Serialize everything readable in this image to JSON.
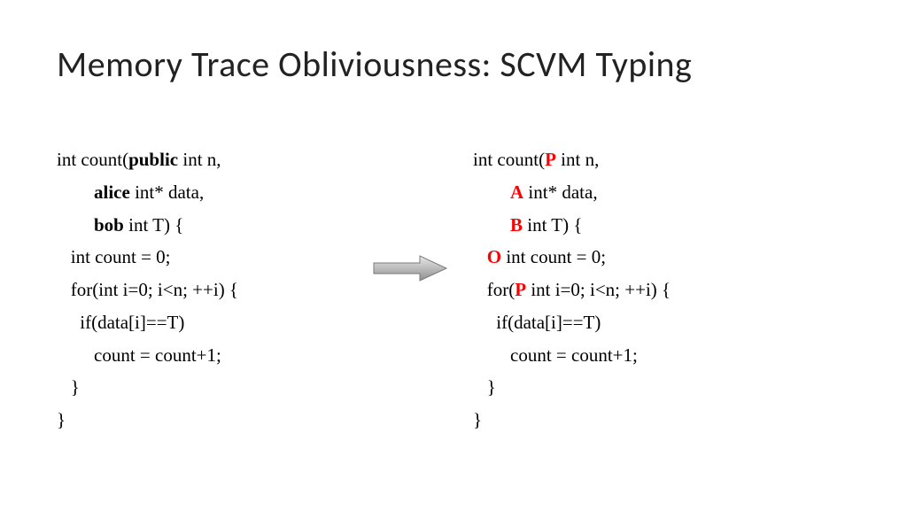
{
  "title": "Memory Trace Obliviousness: SCVM Typing",
  "left": {
    "l1a": "int count(",
    "l1b": "public",
    "l1c": " int n,",
    "l2a": "        ",
    "l2b": "alice",
    "l2c": " int* data,",
    "l3a": "        ",
    "l3b": "bob",
    "l3c": " int T) {",
    "l4": "   int count = 0;",
    "l5": "   for(int i=0; i<n; ++i) {",
    "l6": "     if(data[i]==T)",
    "l7": "        count = count+1;",
    "l8": "   }",
    "l9": "}"
  },
  "right": {
    "l1a": "int count(",
    "l1b": "P",
    "l1c": " int n,",
    "l2a": "        ",
    "l2b": "A",
    "l2c": " int* data,",
    "l3a": "        ",
    "l3b": "B",
    "l3c": " int T) {",
    "l4a": "   ",
    "l4b": "O",
    "l4c": " int count = 0;",
    "l5a": "   for(",
    "l5b": "P",
    "l5c": " int i=0; i<n; ++i) {",
    "l6": "     if(data[i]==T)",
    "l7": "        count = count+1;",
    "l8": "   }",
    "l9": "}"
  }
}
